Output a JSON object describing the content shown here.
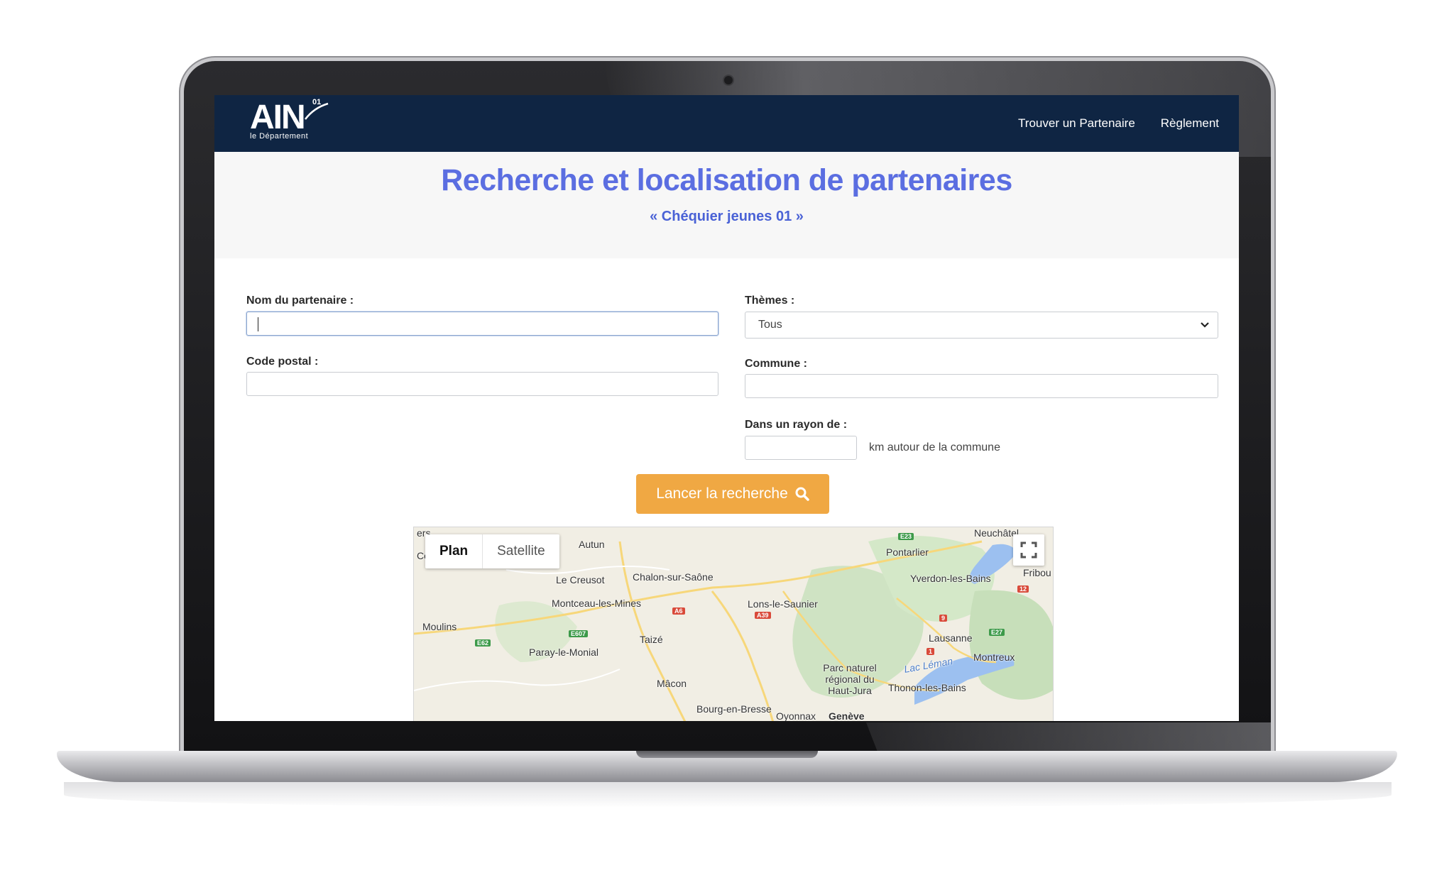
{
  "navbar": {
    "logo_text": "AIN",
    "logo_superscript": "01",
    "logo_subtitle": "le Département",
    "links": [
      "Trouver un Partenaire",
      "Règlement"
    ]
  },
  "hero": {
    "title": "Recherche et localisation de partenaires",
    "subtitle": "« Chéquier jeunes 01 »"
  },
  "form": {
    "nom_label": "Nom du partenaire :",
    "nom_value": "",
    "themes_label": "Thèmes :",
    "themes_selected": "Tous",
    "code_postal_label": "Code postal :",
    "code_postal_value": "",
    "commune_label": "Commune :",
    "commune_value": "",
    "rayon_label": "Dans un rayon de :",
    "rayon_value": "",
    "rayon_suffix": "km autour de la commune",
    "search_button": "Lancer la recherche"
  },
  "map": {
    "type_plan": "Plan",
    "type_satellite": "Satellite",
    "cities": [
      "ers",
      "Autun",
      "Le Creusot",
      "Chalon-sur-Saône",
      "Montceau-les-Mines",
      "Lons-le-Saunier",
      "Moulins",
      "Paray-le-Monial",
      "Taizé",
      "Mâcon",
      "Bourg-en-Bresse",
      "Oyonnax",
      "Genève",
      "Neuchâtel",
      "Pontarlier",
      "Yverdon-les-Bains",
      "Fribou",
      "Lausanne",
      "Montreux",
      "Parc naturel régional du Haut-Jura",
      "Thonon-les-Bains",
      "Lac Léman",
      "Co"
    ],
    "routes": [
      "E23",
      "A6",
      "A39",
      "E607",
      "E62",
      "12",
      "9",
      "E27",
      "1"
    ]
  },
  "colors": {
    "navbar": "#0f2543",
    "title": "#5b6ee1",
    "button": "#f0a843"
  },
  "icons": [
    "search-icon",
    "chevron-down-icon",
    "fullscreen-icon",
    "camera-icon"
  ]
}
